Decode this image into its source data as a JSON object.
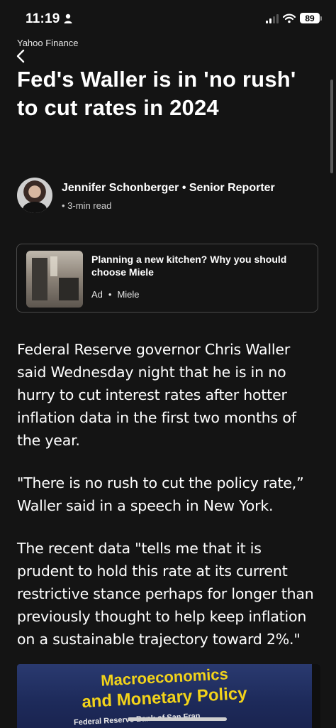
{
  "status_bar": {
    "time": "11:19",
    "battery": "89",
    "icons": [
      "person-icon",
      "signal-icon",
      "wifi-icon",
      "battery-icon"
    ]
  },
  "header": {
    "source": "Yahoo Finance",
    "back_icon": "chevron-left-icon"
  },
  "article": {
    "headline": "Fed's Waller is in 'no rush' to cut rates in 2024",
    "author": {
      "byline": "Jennifer Schonberger • Senior Reporter",
      "read_time": "• 3-min read"
    },
    "paragraphs": [
      "Federal Reserve governor Chris Waller said Wednesday night that he is in no hurry to cut interest rates after hotter inflation data in the first two months of the year.",
      "\"There is no rush to cut the policy rate,” Waller said in a speech in New York.",
      "The recent data \"tells me that it is prudent to hold this rate at its current restrictive stance perhaps for longer than previously thought to help keep inflation on a sustainable trajectory toward 2%.\""
    ],
    "image": {
      "line1": "Macroeconomics",
      "line2": "and Monetary Policy",
      "line3": "Federal Reserve Bank of San Fran"
    }
  },
  "ad": {
    "title": "Planning a new kitchen? Why you should choose Miele",
    "label": "Ad",
    "separator": "•",
    "sponsor": "Miele"
  },
  "colors": {
    "background": "#141414",
    "text": "#ffffff",
    "image_text": "#f2d31a"
  }
}
